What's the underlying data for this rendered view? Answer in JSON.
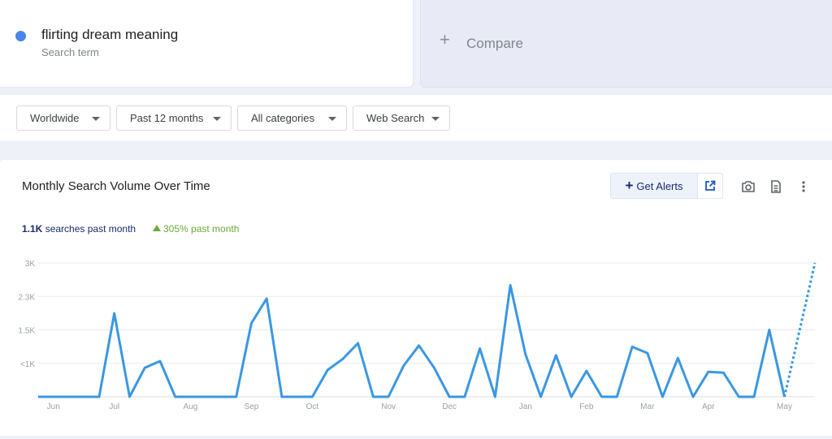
{
  "term": {
    "name": "flirting dream meaning",
    "subtitle": "Search term",
    "dot_color": "#4a86e8"
  },
  "compare": {
    "label": "Compare",
    "icon": "plus-icon"
  },
  "filters": [
    {
      "label": "Worldwide"
    },
    {
      "label": "Past 12 months"
    },
    {
      "label": "All categories"
    },
    {
      "label": "Web Search"
    }
  ],
  "chart_card": {
    "title": "Monthly Search Volume Over Time",
    "alerts_label": "Get Alerts",
    "icons": [
      "plus-icon",
      "external-link-icon",
      "camera-icon",
      "document-icon",
      "more-vert-icon"
    ],
    "volume_value": "1.1K",
    "volume_label": "searches past month",
    "growth_label": "305% past month",
    "accent_color": "#3b97e3",
    "growth_color": "#6aaa3a"
  },
  "chart_data": {
    "type": "line",
    "ytick_labels": [
      "3K",
      "2.3K",
      "1.5K",
      "<1K"
    ],
    "ytick_values": [
      3000,
      2250,
      1500,
      750
    ],
    "ylim": [
      0,
      3000
    ],
    "xtick_labels": [
      "Jun",
      "Jul",
      "Aug",
      "Sep",
      "Oct",
      "Nov",
      "Dec",
      "Jan",
      "Feb",
      "Mar",
      "Apr",
      "May"
    ],
    "xtick_index": [
      1,
      5,
      10,
      14,
      18,
      23,
      27,
      32,
      36,
      40,
      44,
      49
    ],
    "xlim": [
      0,
      51
    ],
    "grid": true,
    "values": [
      0,
      0,
      0,
      0,
      0,
      1870,
      0,
      650,
      800,
      0,
      0,
      0,
      0,
      0,
      1650,
      2200,
      0,
      0,
      0,
      600,
      850,
      1200,
      0,
      0,
      700,
      1150,
      650,
      0,
      0,
      1080,
      0,
      2500,
      950,
      0,
      930,
      0,
      580,
      0,
      0,
      1120,
      980,
      0,
      870,
      0,
      560,
      540,
      0,
      0,
      1500,
      0
    ],
    "projection": {
      "from_index": 49,
      "from_value": 0,
      "to_index": 51,
      "to_value": 3000
    }
  }
}
